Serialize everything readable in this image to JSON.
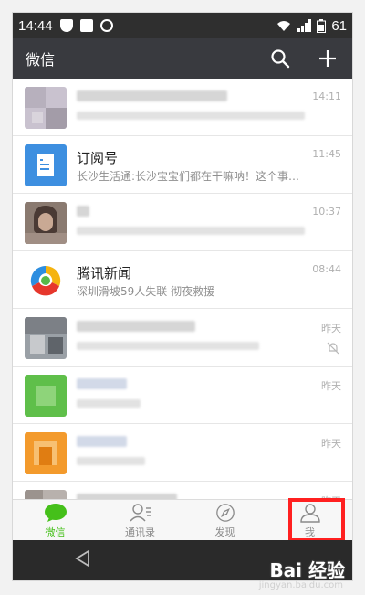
{
  "status_bar": {
    "time": "14:44",
    "battery": "61"
  },
  "app_bar": {
    "title": "微信"
  },
  "chats": [
    {
      "name": "",
      "preview": "",
      "time": "14:11",
      "avatar_color": "#c9c2cf"
    },
    {
      "name": "订阅号",
      "preview": "长沙生活通:长沙宝宝们都在干嘛呐！这个事情千...",
      "time": "11:45",
      "avatar_color": "#3d8fe0"
    },
    {
      "name": "",
      "preview": "",
      "time": "10:37",
      "avatar_color": "#8a7a70"
    },
    {
      "name": "腾讯新闻",
      "preview": "深圳滑坡59人失联 彻夜救援",
      "time": "08:44",
      "avatar_color": "#ffffff"
    },
    {
      "name": "",
      "preview": "",
      "time": "昨天",
      "avatar_color": "#9aa0a6",
      "muted": true
    },
    {
      "name": "",
      "preview": "",
      "time": "昨天",
      "avatar_color": "#5fbf4a"
    },
    {
      "name": "",
      "preview": "",
      "time": "昨天",
      "avatar_color": "#f39a2c"
    },
    {
      "name": "",
      "preview": "",
      "time": "昨天",
      "avatar_color": "#b8b1ad"
    }
  ],
  "tabs": [
    {
      "label": "微信",
      "active": true
    },
    {
      "label": "通讯录",
      "active": false
    },
    {
      "label": "发现",
      "active": false
    },
    {
      "label": "我",
      "active": false
    }
  ],
  "watermark": {
    "main": "Bai 经验",
    "sub": "jingyan.baidu.com"
  },
  "colors": {
    "accent": "#45c01a",
    "app_bar": "#393a3f",
    "highlight": "#ff2020"
  }
}
